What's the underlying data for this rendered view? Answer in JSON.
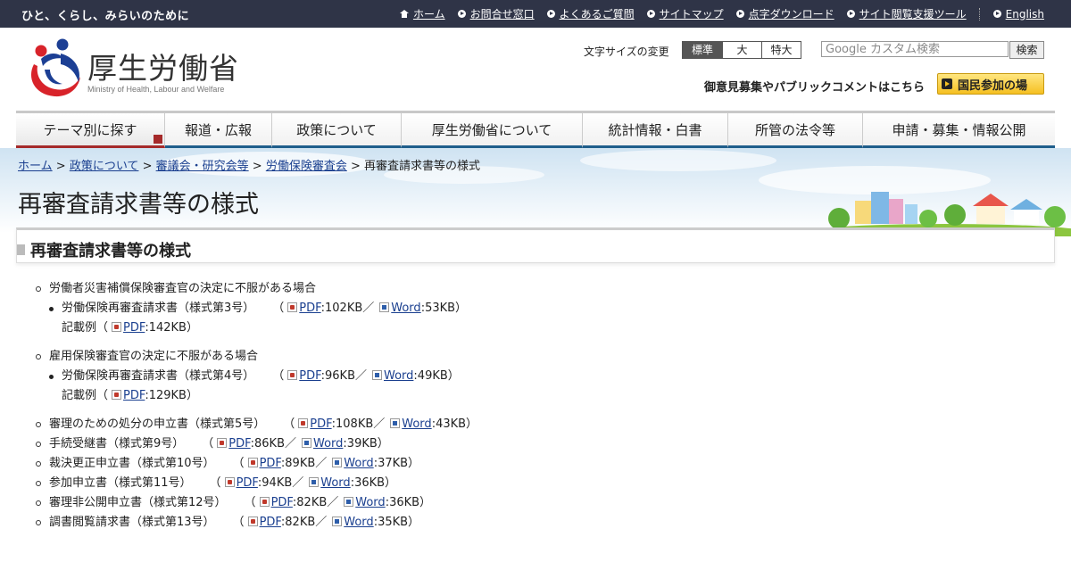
{
  "topbar": {
    "tagline": "ひと、くらし、みらいのために",
    "links": [
      "ホーム",
      "お問合せ窓口",
      "よくあるご質問",
      "サイトマップ",
      "点字ダウンロード",
      "サイト閲覧支援ツール",
      "English"
    ]
  },
  "header": {
    "org_name": "厚生労働省",
    "org_name_en": "Ministry of Health, Labour and Welfare",
    "font_size_label": "文字サイズの変更",
    "font_sizes": [
      "標準",
      "大",
      "特大"
    ],
    "search_placeholder": "Google カスタム検索",
    "search_button": "検索",
    "public_comment": "御意見募集やパブリックコメントはこちら",
    "participation_button": "国民参加の場"
  },
  "nav": [
    "テーマ別に探す",
    "報道・広報",
    "政策について",
    "厚生労働省について",
    "統計情報・白書",
    "所管の法令等",
    "申請・募集・情報公開"
  ],
  "breadcrumb": {
    "items": [
      "ホーム",
      "政策について",
      "審議会・研究会等",
      "労働保険審査会"
    ],
    "separator": ">",
    "current": "再審査請求書等の様式"
  },
  "page_title": "再審査請求書等の様式",
  "section_title": "再審査請求書等の様式",
  "content": {
    "group1": {
      "title": "労働者災害補償保険審査官の決定に不服がある場合",
      "item": "労働保険再審査請求書（様式第3号）",
      "pdf": "PDF",
      "pdf_size": ":102KB／",
      "word": "Word",
      "word_size": ":53KB）",
      "example": "記載例（",
      "example_pdf": "PDF",
      "example_size": ":142KB）"
    },
    "group2": {
      "title": "雇用保険審査官の決定に不服がある場合",
      "item": "労働保険再審査請求書（様式第4号）",
      "pdf": "PDF",
      "pdf_size": ":96KB／",
      "word": "Word",
      "word_size": ":49KB）",
      "example": "記載例（",
      "example_pdf": "PDF",
      "example_size": ":129KB）"
    },
    "forms": [
      {
        "name": "審理のための処分の申立書（様式第5号）",
        "pdf_size": ":108KB／",
        "word_size": ":43KB）"
      },
      {
        "name": "手続受継書（様式第9号）",
        "pdf_size": ":86KB／",
        "word_size": ":39KB）"
      },
      {
        "name": "裁決更正申立書（様式第10号）",
        "pdf_size": ":89KB／",
        "word_size": ":37KB）"
      },
      {
        "name": "参加申立書（様式第11号）",
        "pdf_size": ":94KB／",
        "word_size": ":36KB）"
      },
      {
        "name": "審理非公開申立書（様式第12号）",
        "pdf_size": ":82KB／",
        "word_size": ":36KB）"
      },
      {
        "name": "調書閲覧請求書（様式第13号）",
        "pdf_size": ":82KB／",
        "word_size": ":35KB）"
      }
    ],
    "open_paren": "（",
    "pdf_label": "PDF",
    "word_label": "Word"
  },
  "colors": {
    "topbar": "#2f3447",
    "nav_accent": "#1f5e8c",
    "nav_active": "#a52a2a",
    "link": "#1a3f8f",
    "participation_button": "#f5c022"
  }
}
